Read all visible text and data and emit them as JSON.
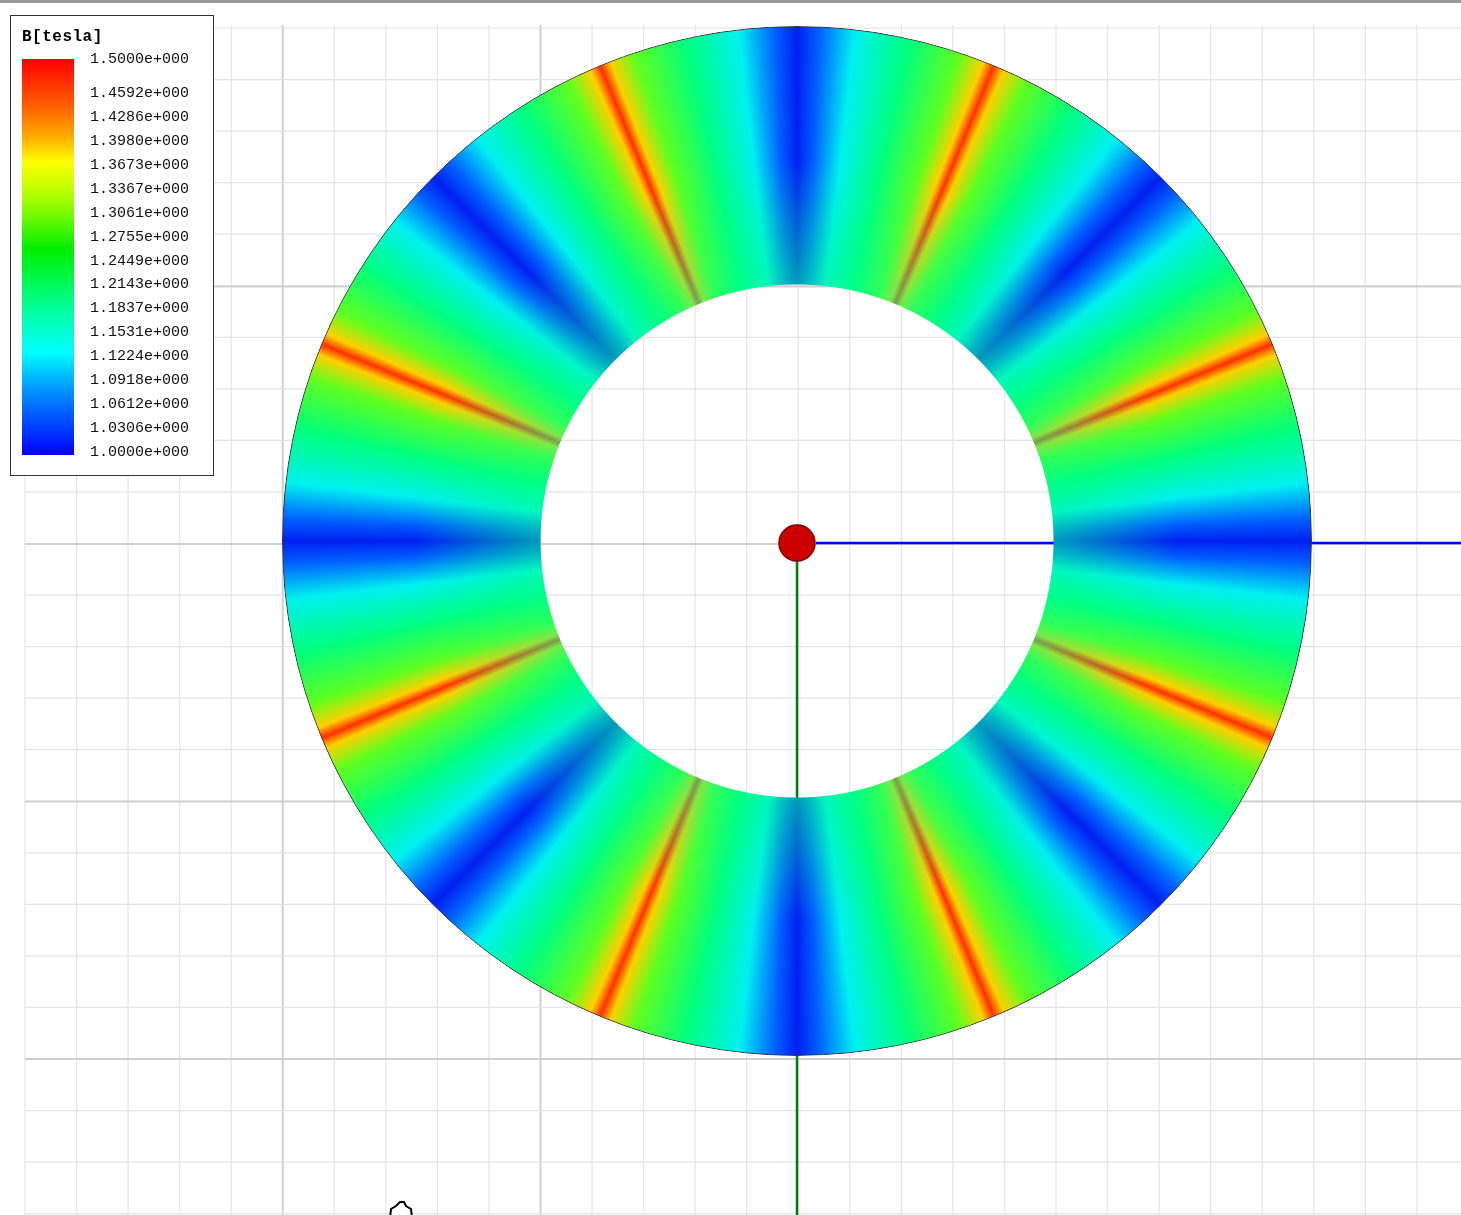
{
  "legend": {
    "title": "B[tesla]",
    "values": [
      "1.5000e+000",
      "1.4592e+000",
      "1.4286e+000",
      "1.3980e+000",
      "1.3673e+000",
      "1.3367e+000",
      "1.3061e+000",
      "1.2755e+000",
      "1.2449e+000",
      "1.2143e+000",
      "1.1837e+000",
      "1.1531e+000",
      "1.1224e+000",
      "1.0918e+000",
      "1.0612e+000",
      "1.0306e+000",
      "1.0000e+000"
    ]
  }
}
